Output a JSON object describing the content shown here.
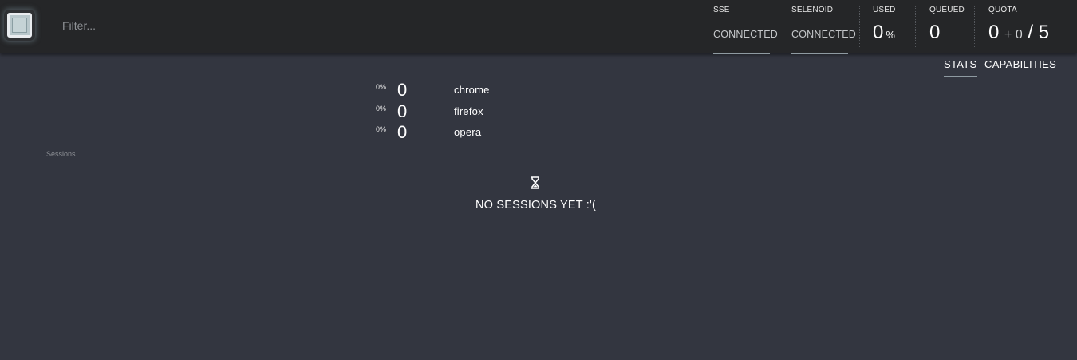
{
  "header": {
    "filter_placeholder": "Filter...",
    "sse": {
      "label": "SSE",
      "status": "CONNECTED"
    },
    "selenoid": {
      "label": "SELENOID",
      "status": "CONNECTED"
    },
    "used": {
      "label": "USED",
      "value": "0",
      "unit": "%"
    },
    "queued": {
      "label": "QUEUED",
      "value": "0"
    },
    "quota": {
      "label": "QUOTA",
      "used": "0",
      "pending": "+ 0",
      "separator": "/",
      "total": "5"
    }
  },
  "tabs": {
    "stats": "STATS",
    "capabilities": "CAPABILITIES",
    "active": "STATS"
  },
  "browsers": [
    {
      "percent": "0%",
      "count": "0",
      "name": "chrome"
    },
    {
      "percent": "0%",
      "count": "0",
      "name": "firefox"
    },
    {
      "percent": "0%",
      "count": "0",
      "name": "opera"
    }
  ],
  "sessions": {
    "label": "Sessions",
    "empty_icon": "hourglass-icon",
    "empty_message": "NO SESSIONS YET :'("
  },
  "colors": {
    "background": "#333640",
    "topbar": "#252628",
    "accent_underline": "#8e9aa1",
    "logo": "#c5d3d6"
  }
}
